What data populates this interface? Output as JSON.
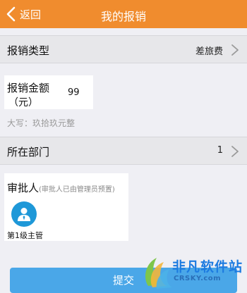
{
  "header": {
    "back_label": "返回",
    "title": "我的报销"
  },
  "form": {
    "type": {
      "label": "报销类型",
      "value": "差旅费"
    },
    "amount": {
      "label_line1": "报销金额",
      "label_line2": "（元）",
      "value": "99"
    },
    "uppercase": "大写：玖拾玖元整",
    "department": {
      "label": "所在部门",
      "value": "1"
    },
    "approver": {
      "label": "审批人",
      "hint": "(审批人已由管理员预置)",
      "role": "第1级主管"
    }
  },
  "submit_label": "提交",
  "watermark": {
    "name": "非凡软件站",
    "url": "CRSKY.com"
  },
  "colors": {
    "header_bg": "#f08c2e",
    "accent_blue": "#1e98d8",
    "submit_bg": "#4aa7e8"
  }
}
